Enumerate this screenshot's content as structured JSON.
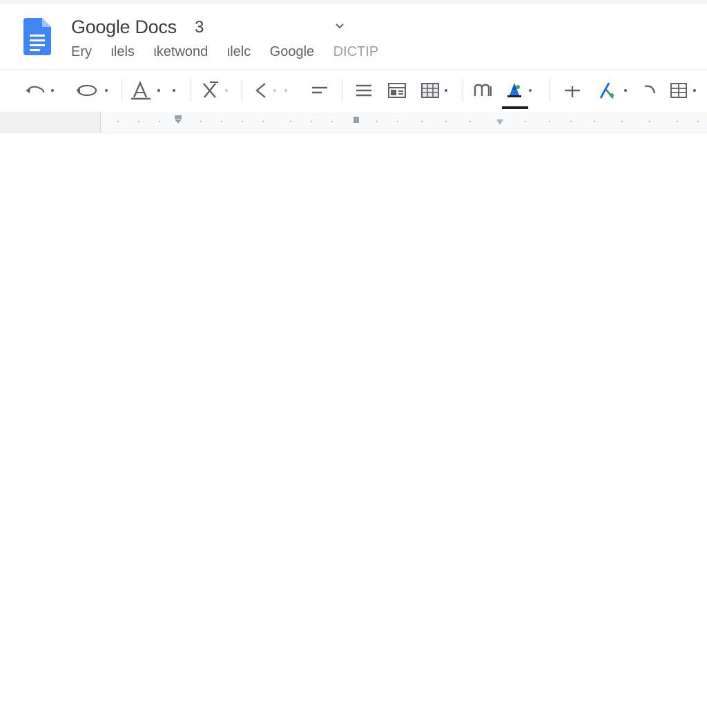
{
  "window": {
    "title": "Google Docs",
    "title_badge": "3"
  },
  "menu": {
    "items": [
      "Ery",
      "ιlels",
      "ιketwond",
      "ιlelc",
      "Google",
      "DICTIP"
    ]
  },
  "toolbar": {
    "buttons": [
      {
        "icon": "undo-icon"
      },
      {
        "icon": "redo-icon"
      },
      {
        "icon": "text-style-icon"
      },
      {
        "icon": "clear-format-icon"
      },
      {
        "icon": "back-chevron-icon"
      },
      {
        "icon": "align-icon"
      },
      {
        "icon": "list-icon"
      },
      {
        "icon": "layout-icon"
      },
      {
        "icon": "table-icon"
      },
      {
        "icon": "font-m-icon"
      },
      {
        "icon": "highlight-color-icon"
      },
      {
        "icon": "insert-plus-icon"
      },
      {
        "icon": "edit-pen-icon"
      },
      {
        "icon": "curve-arrow-icon"
      },
      {
        "icon": "grid-icon"
      }
    ]
  },
  "colors": {
    "brand_blue": "#4285f4",
    "icon_gray": "#5f6368",
    "text_dark": "#3c4043",
    "accent_blue": "#1a73e8",
    "accent_teal": "#34a853"
  }
}
